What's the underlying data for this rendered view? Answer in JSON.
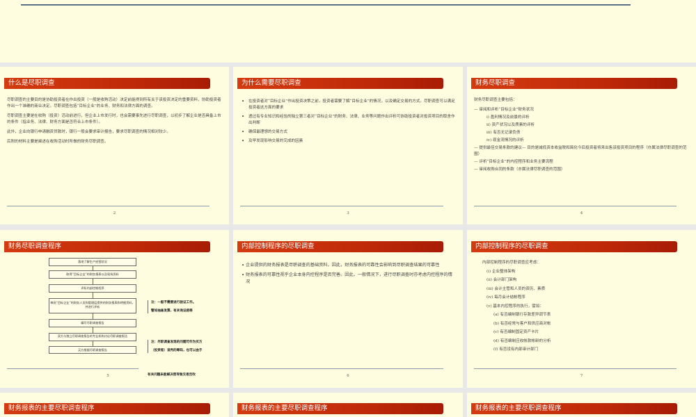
{
  "slides": [
    {
      "title": "什么是尽职调查",
      "paragraphs": [
        "尽职调查的主要目的是协助投资者在作出投资（一般是收购活动）决定前能得到所有关于该投资决定的重要资料，协助投资者作出一个准确的商业决定。尽职调查包括“目标企业”的业务、财务和法律方面的调查。",
        "尽职调查主要是在收购（投资）活动前进行，但企业上市发行时，也会需要事先进行尽职调查，以初步了解企业是否具备上市的条件（指业务、法律、财务方面是否符合上市条件）。",
        "此外，企业向银行申请融资贷款时，银行一般会要求审计报告，要求尽职调查的情况相对较少。",
        "后附的材料主要是阐述在收购活动时所做的财务尽职调查。"
      ],
      "page": "2"
    },
    {
      "title": "为什么需要尽职调查",
      "bullets": [
        "在投资者对“目标企业”作出投资决策之前，投资者需要了解“目标企业”的情况，以及确定交易的方式。尽职调查可以满足投资者这方面的要求",
        "透过有专业知识和经验的独立第三者对“目标企业”的财务、法律、业务等问题作出评析可协助投资者对投资项目的取舍作出判断",
        "确保最理想的交易方式",
        "及早发现影响交易的完成的因素"
      ],
      "page": "3"
    },
    {
      "title": "财务尽职调查",
      "intro": "财务尽职调查主要包括：",
      "items": [
        {
          "text": "— 审阅和评析“目标企业”财务状况",
          "level": 0
        },
        {
          "text": "i) 盈利情况及前景的评析",
          "level": 1
        },
        {
          "text": "ii) 资产状况以及质素的评析",
          "level": 1
        },
        {
          "text": "iii) 有否无记录负债",
          "level": 1
        },
        {
          "text": "iv) 现金流情况的评析",
          "level": 1
        },
        {
          "text": "— 提供最佳交易条款的建议— 目的是减低资本收益税和简化今后投资者将来出售该投资项目的程序（亦属法律尽职调查的范围）",
          "level": 0
        },
        {
          "text": "— 评析“目标企业”的内控程序和业务主要流程",
          "level": 0
        },
        {
          "text": "— 审阅收购合同的条款（亦属法律尽职调查的范围）",
          "level": 0
        }
      ],
      "page": "4"
    },
    {
      "title": "财务尽职调查程序",
      "flow": [
        "落地了解生产经营状况",
        "取得“目标企业”的财务报表以及现场资料",
        "评析内部控制程序",
        "审阅“目标企业”的财务人员和管理层提供的财务报表和明细资料，并进行评析",
        "编写尽职调查报告",
        "双方与独立尽职调查报告的专业机构讨论尽职调查报告",
        "买方根据尽职调查报告"
      ],
      "notes": [
        "注：一般不需要进行验证工作。",
        "警如抽查发票、有关询证函等",
        "注：尽职调查发现的问题可作为买方",
        "（投资者）谈判的筹码，也可以由于",
        "有关问题未能解决而导致交易告吹"
      ],
      "page": "5"
    },
    {
      "title": "内部控制程序的尽职调查",
      "bullets": [
        "企业提供的财务报表是尽职调查的基础资料，因此，财务报表的可靠性会影响到尽职调查结果的可靠性",
        "财务报表的可靠性视乎企业本身内控程序是否完善。因此，一般情况下，进行尽职调查时亦考虑内控程序的情况"
      ],
      "page": "6"
    },
    {
      "title": "内部控制程序的尽职调查",
      "intro": "内部控制程序的尽职调查应考虑：",
      "items": [
        {
          "text": "(i)   企业整体架构",
          "level": 1
        },
        {
          "text": "(ii)  会计部门架构",
          "level": 1
        },
        {
          "text": "(iii) 会计主管和人员的资历、素质",
          "level": 1
        },
        {
          "text": "(iv) 每月会计结帐程序",
          "level": 1
        },
        {
          "text": "(v)  基本内控程序的执行，譬如：",
          "level": 1
        },
        {
          "text": "(a) 有否编制银行存款差异调节表",
          "level": 2
        },
        {
          "text": "(b) 有否经常与客户和供应商对帐",
          "level": 2
        },
        {
          "text": "(c) 有否编制固定资产卡片",
          "level": 2
        },
        {
          "text": "(d) 有否编制应收帐款帐龄的分析",
          "level": 2
        },
        {
          "text": "(f) 有否设有内部审计部门",
          "level": 2
        }
      ],
      "page": "7"
    },
    {
      "title": "财务报表的主要尽职调查程序"
    },
    {
      "title": "财务报表的主要尽职调查程序"
    },
    {
      "title": "财务报表的主要尽职调查程序"
    }
  ]
}
